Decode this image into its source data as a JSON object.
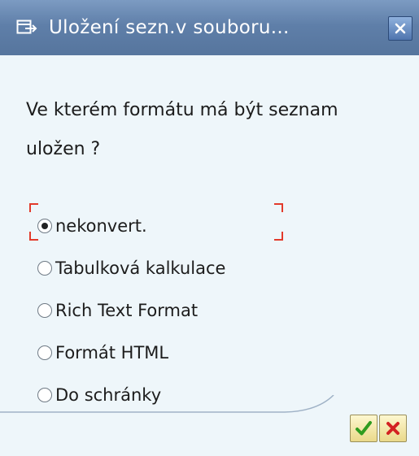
{
  "window": {
    "title": "Uložení sezn.v souboru..."
  },
  "dialog": {
    "question": "Ve kterém formátu má být seznam uložen ?",
    "options": [
      {
        "label": "nekonvert.",
        "selected": true
      },
      {
        "label": "Tabulková kalkulace",
        "selected": false
      },
      {
        "label": "Rich Text Format",
        "selected": false
      },
      {
        "label": "Formát HTML",
        "selected": false
      },
      {
        "label": "Do schránky",
        "selected": false
      }
    ]
  },
  "buttons": {
    "ok_icon": "checkmark-icon",
    "cancel_icon": "cancel-x-icon"
  },
  "colors": {
    "titlebar": "#5f7fa9",
    "background": "#eef6fa",
    "focus_frame": "#e23a2b",
    "ok_check": "#2f9c1f",
    "cancel_x": "#d32222"
  }
}
